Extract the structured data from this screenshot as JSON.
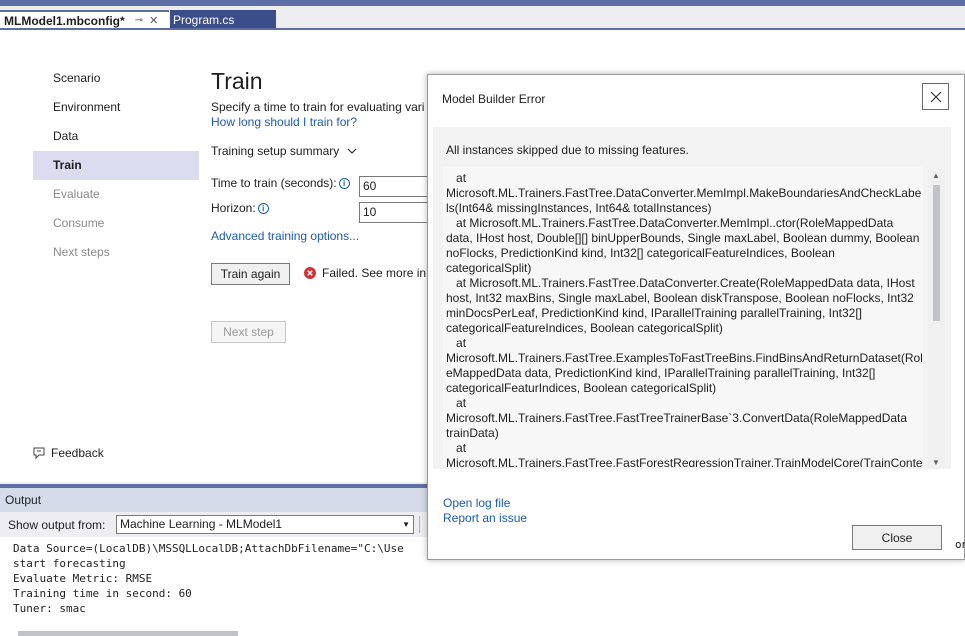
{
  "tabs": {
    "active_title": "MLModel1.mbconfig*",
    "pin_glyph": "⊸",
    "close_glyph": "✕",
    "inactive_title": "Program.cs"
  },
  "nav": {
    "items": [
      {
        "label": "Scenario",
        "state": "normal"
      },
      {
        "label": "Environment",
        "state": "normal"
      },
      {
        "label": "Data",
        "state": "normal"
      },
      {
        "label": "Train",
        "state": "selected"
      },
      {
        "label": "Evaluate",
        "state": "disabled"
      },
      {
        "label": "Consume",
        "state": "disabled"
      },
      {
        "label": "Next steps",
        "state": "disabled"
      }
    ],
    "feedback_label": "Feedback"
  },
  "train": {
    "title": "Train",
    "description": "Specify a time to train for evaluating vari",
    "how_long_link": "How long should I train for?",
    "setup_summary": "Training setup summary",
    "time_label": "Time to train (seconds):",
    "time_value": "60",
    "horizon_label": "Horizon:",
    "horizon_value": "10",
    "advanced_link": "Advanced training options...",
    "train_again_label": "Train again",
    "failed_text": "Failed. See more in (",
    "next_step_label": "Next step"
  },
  "output": {
    "title": "Output",
    "show_from_label": "Show output from:",
    "source_selected": "Machine Learning - MLModel1",
    "lines": [
      "Data Source=(LocalDB)\\MSSQLLocalDB;AttachDbFilename=\"C:\\Use",
      "start forecasting",
      "Evaluate Metric: RMSE",
      "Training time in second: 60",
      "Tuner: smac"
    ],
    "right_edge_text": "on"
  },
  "dialog": {
    "title": "Model Builder Error",
    "message": "All instances skipped due to missing features.",
    "stack_trace": "   at Microsoft.ML.Trainers.FastTree.DataConverter.MemImpl.MakeBoundariesAndCheckLabels(Int64& missingInstances, Int64& totalInstances)\n   at Microsoft.ML.Trainers.FastTree.DataConverter.MemImpl..ctor(RoleMappedData data, IHost host, Double[][] binUpperBounds, Single maxLabel, Boolean dummy, Boolean noFlocks, PredictionKind kind, Int32[] categoricalFeatureIndices, Boolean categoricalSplit)\n   at Microsoft.ML.Trainers.FastTree.DataConverter.Create(RoleMappedData data, IHost host, Int32 maxBins, Single maxLabel, Boolean diskTranspose, Boolean noFlocks, Int32 minDocsPerLeaf, PredictionKind kind, IParallelTraining parallelTraining, Int32[] categoricalFeatureIndices, Boolean categoricalSplit)\n   at Microsoft.ML.Trainers.FastTree.ExamplesToFastTreeBins.FindBinsAndReturnDataset(RoleMappedData data, PredictionKind kind, IParallelTraining parallelTraining, Int32[] categoricalFeaturIndices, Boolean categoricalSplit)\n   at Microsoft.ML.Trainers.FastTree.FastTreeTrainerBase`3.ConvertData(RoleMappedData trainData)\n   at Microsoft.ML.Trainers.FastTree.FastForestRegressionTrainer.TrainModelCore(TrainContext context)\n   at Microsoft.ML.Trainers.TrainerEstimatorBase`2.TrainTransformer(IDataView trainSet, IDataView validationSet, IPredictor initPredictor)\n   at Microsoft.ML.AutoML.SmacTuner.FitModel(IEnumerable`1 history)",
    "open_log_link": "Open log file",
    "report_issue_link": "Report an issue",
    "close_label": "Close"
  }
}
